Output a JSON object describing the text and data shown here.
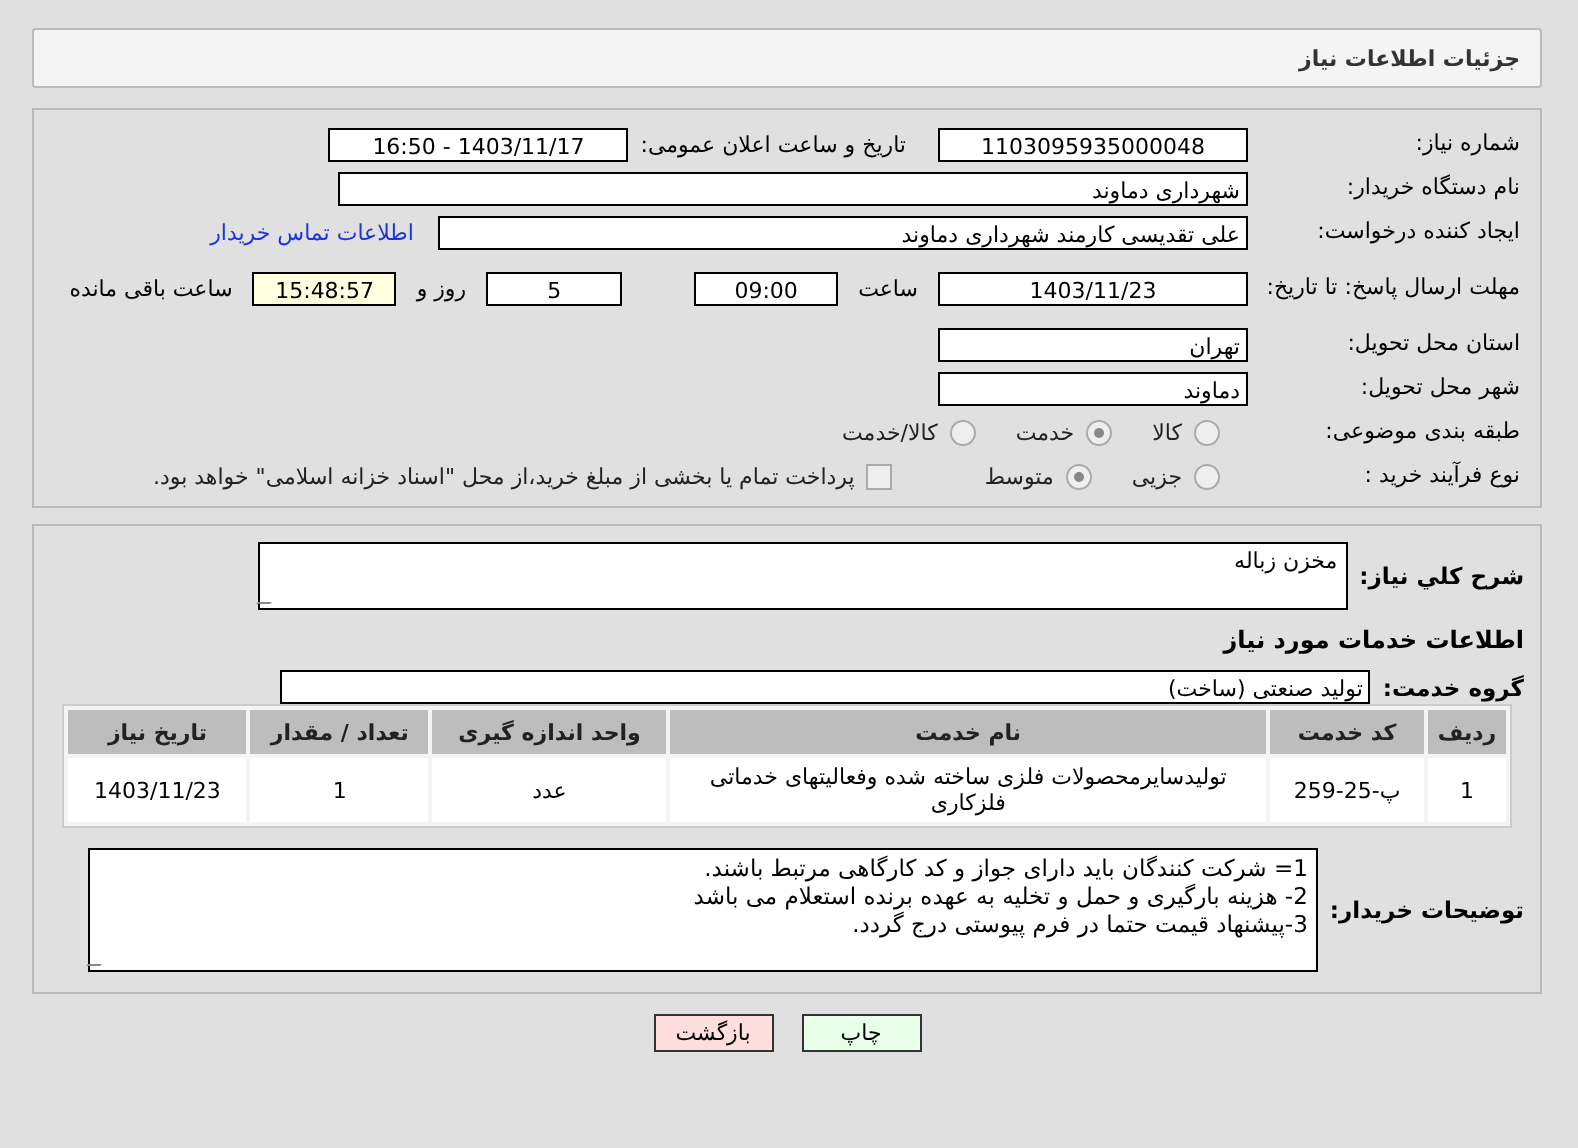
{
  "header": {
    "title": "جزئیات اطلاعات نیاز"
  },
  "need_number": {
    "label": "شماره نیاز:",
    "value": "1103095935000048"
  },
  "announce": {
    "label": "تاریخ و ساعت اعلان عمومی:",
    "value": "1403/11/17 - 16:50"
  },
  "buyer": {
    "label": "نام دستگاه خریدار:",
    "value": "شهرداری دماوند"
  },
  "creator": {
    "label": "ایجاد کننده درخواست:",
    "value": "علی تقدیسی کارمند شهرداری دماوند",
    "link": "اطلاعات تماس خریدار"
  },
  "deadline": {
    "label": "مهلت ارسال پاسخ: تا تاریخ:",
    "date": "1403/11/23",
    "time_label": "ساعت",
    "time": "09:00",
    "days": "5",
    "days_label": "روز و",
    "remaining": "15:48:57",
    "remaining_label": "ساعت باقی مانده"
  },
  "province": {
    "label": "استان محل تحویل:",
    "value": "تهران"
  },
  "city": {
    "label": "شهر محل تحویل:",
    "value": "دماوند"
  },
  "category": {
    "label": "طبقه بندی موضوعی:",
    "options": [
      {
        "label": "کالا",
        "selected": false
      },
      {
        "label": "خدمت",
        "selected": true
      },
      {
        "label": "کالا/خدمت",
        "selected": false
      }
    ]
  },
  "purchase_type": {
    "label": "نوع فرآیند خرید :",
    "options": [
      {
        "label": "جزیی",
        "selected": false
      },
      {
        "label": "متوسط",
        "selected": true
      }
    ],
    "payment": {
      "label": "پرداخت تمام یا بخشی از مبلغ خرید،از محل \"اسناد خزانه اسلامی\" خواهد بود.",
      "checked": false
    }
  },
  "description": {
    "label": "شرح کلي نياز:",
    "value": "مخزن زباله"
  },
  "services_heading": "اطلاعات خدمات مورد نیاز",
  "service_group": {
    "label": "گروه خدمت:",
    "value": "تولید صنعتی (ساخت)"
  },
  "table": {
    "columns": [
      "ردیف",
      "کد خدمت",
      "نام خدمت",
      "واحد اندازه گیری",
      "تعداد / مقدار",
      "تاریخ نیاز"
    ],
    "rows": [
      [
        "1",
        "پ-25-259",
        "تولیدسایرمحصولات فلزی ساخته شده وفعالیتهای خدماتی فلزکاری",
        "عدد",
        "1",
        "1403/11/23"
      ]
    ]
  },
  "buyer_notes": {
    "label": "توضیحات خریدار:",
    "lines": [
      "1= شرکت کنندگان باید دارای جواز و کد کارگاهی مرتبط باشند.",
      "2- هزینه بارگیری و حمل و تخلیه به عهده برنده استعلام می باشد",
      "3-پیشنهاد قیمت حتما در فرم پیوستی درج گردد."
    ]
  },
  "buttons": [
    {
      "label": "چاپ",
      "kind": "print"
    },
    {
      "label": "بازگشت",
      "kind": "back"
    }
  ]
}
